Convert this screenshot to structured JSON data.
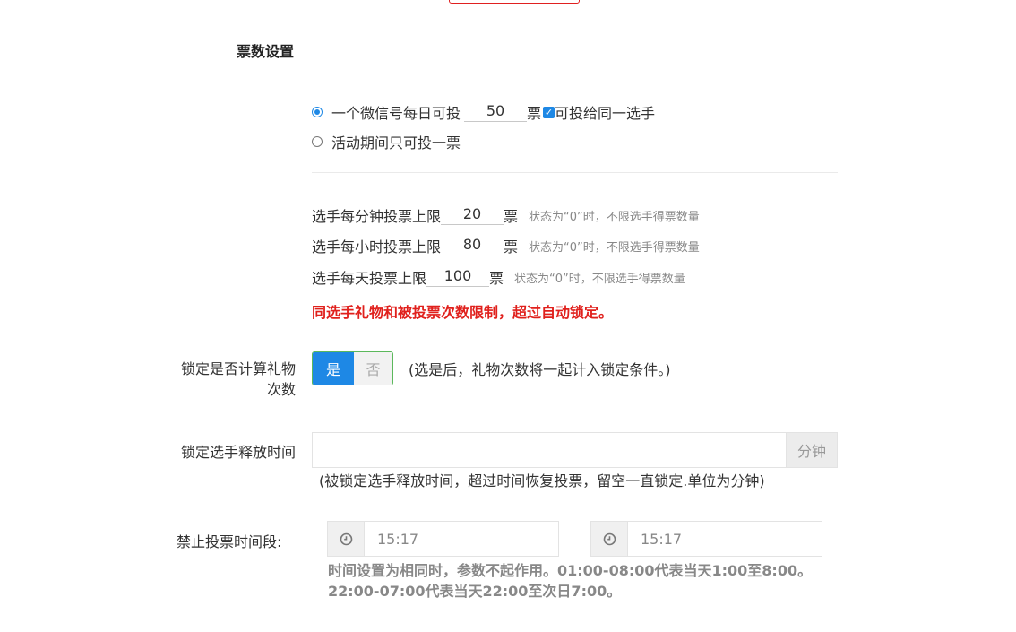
{
  "section_title": "票数设置",
  "vote_mode": {
    "option_daily": {
      "prefix": "一个微信号每日可投",
      "value": "50",
      "unit": "票",
      "same_player_checkbox_label": "可投给同一选手",
      "selected": true,
      "same_player_checked": true
    },
    "option_once": {
      "label": "活动期间只可投一票",
      "selected": false
    }
  },
  "limits": {
    "per_minute": {
      "label": "选手每分钟投票上限",
      "value": "20",
      "unit": "票",
      "hint": "状态为“0”时，不限选手得票数量"
    },
    "per_hour": {
      "label": "选手每小时投票上限",
      "value": "80",
      "unit": "票",
      "hint": "状态为“0”时，不限选手得票数量"
    },
    "per_day": {
      "label": "选手每天投票上限",
      "value": "100",
      "unit": "票",
      "hint": "状态为“0”时，不限选手得票数量"
    },
    "warning": "同选手礼物和被投票次数限制，超过自动锁定。"
  },
  "lock_gift": {
    "label_line1": "锁定是否计算礼物",
    "label_line2": "次数",
    "yes": "是",
    "no": "否",
    "selected": "是",
    "hint": "(选是后，礼物次数将一起计入锁定条件。)"
  },
  "release_time": {
    "label": "锁定选手释放时间",
    "value": "",
    "addon": "分钟",
    "hint": "(被锁定选手释放时间，超过时间恢复投票，留空一直锁定.单位为分钟)"
  },
  "forbid_period": {
    "label": "禁止投票时间段:",
    "start": "15:17",
    "end": "15:17",
    "icon": "clock-icon",
    "note_line1": "时间设置为相同时，参数不起作用。01:00-08:00代表当天1:00至8:00。",
    "note_line2": "22:00-07:00代表当天22:00至次日7:00。"
  },
  "colors": {
    "accent": "#1e88e5",
    "warning": "#e0201c",
    "toggle_border": "#5cb85c"
  }
}
